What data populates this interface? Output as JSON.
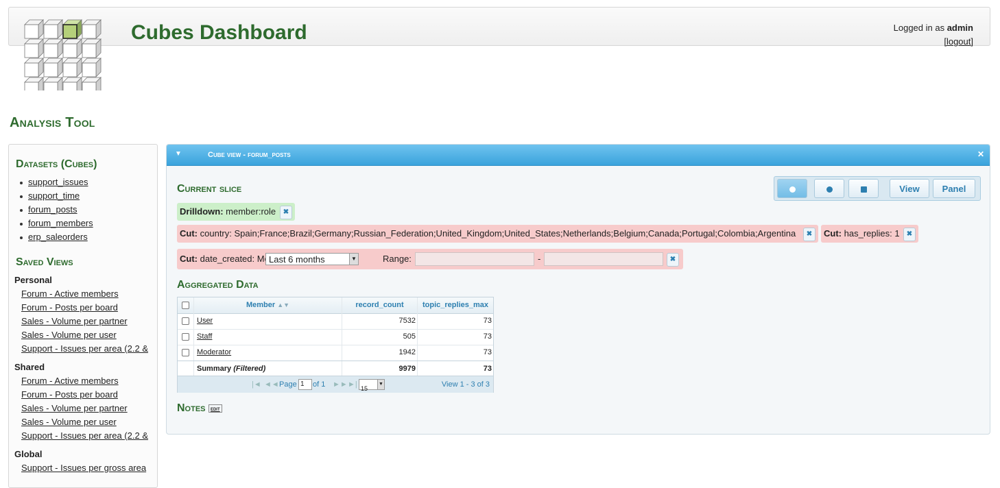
{
  "header": {
    "app_title": "Cubes Dashboard",
    "logged_in_prefix": "Logged in as",
    "username": "admin",
    "logout_label": "[logout]"
  },
  "page_heading": "Analysis Tool",
  "sidebar": {
    "datasets_heading": "Datasets (Cubes)",
    "datasets": [
      "support_issues",
      "support_time",
      "forum_posts",
      "forum_members",
      "erp_saleorders"
    ],
    "saved_views_heading": "Saved Views",
    "groups": [
      {
        "label": "Personal",
        "items": [
          "Forum - Active members",
          "Forum - Posts per board",
          "Sales - Volume per partner",
          "Sales - Volume per user",
          "Support - Issues per area (2.2 &"
        ]
      },
      {
        "label": "Shared",
        "items": [
          "Forum - Active members",
          "Forum - Posts per board",
          "Sales - Volume per partner",
          "Sales - Volume per user",
          "Support - Issues per area (2.2 &"
        ]
      },
      {
        "label": "Global",
        "items": [
          "Support - Issues per gross area"
        ]
      }
    ]
  },
  "panel": {
    "title": "Cube view - forum_posts",
    "current_slice_heading": "Current slice",
    "toolbar": {
      "view_label": "View",
      "panel_label": "Panel"
    },
    "drilldown": {
      "label": "Drilldown:",
      "value": "member:role"
    },
    "cuts": [
      {
        "label": "Cut:",
        "value": "country: Spain;France;Brazil;Germany;Russian_Federation;United_Kingdom;United_States;Netherlands;Belgium;Canada;Portugal;Colombia;Argentina"
      },
      {
        "label": "Cut:",
        "value": "has_replies: 1"
      }
    ],
    "date_cut": {
      "label": "Cut:",
      "field": "date_created:",
      "mode_label": "Mode:",
      "mode_value": "Last 6 months",
      "range_label": "Range:",
      "range_sep": "-"
    },
    "aggregated_heading": "Aggregated Data",
    "grid": {
      "columns": [
        "Member",
        "record_count",
        "topic_replies_max"
      ],
      "rows": [
        {
          "member": "User",
          "record_count": "7532",
          "topic_replies_max": "73"
        },
        {
          "member": "Staff",
          "record_count": "505",
          "topic_replies_max": "73"
        },
        {
          "member": "Moderator",
          "record_count": "1942",
          "topic_replies_max": "73"
        }
      ],
      "summary": {
        "label": "Summary",
        "qualifier": "(Filtered)",
        "record_count": "9979",
        "topic_replies_max": "73"
      },
      "pager": {
        "page_label": "Page",
        "page_value": "1",
        "of_label": "of 1",
        "rows_value": "15",
        "view_label": "View 1 - 3 of 3"
      }
    },
    "notes_heading": "Notes",
    "notes_edit": "edit"
  },
  "colors": {
    "accent_green": "#2e6b2e",
    "header_blue": "#3aa3dc",
    "drilldown_bg": "#ccefc9",
    "cut_bg": "#f7cbcb"
  }
}
